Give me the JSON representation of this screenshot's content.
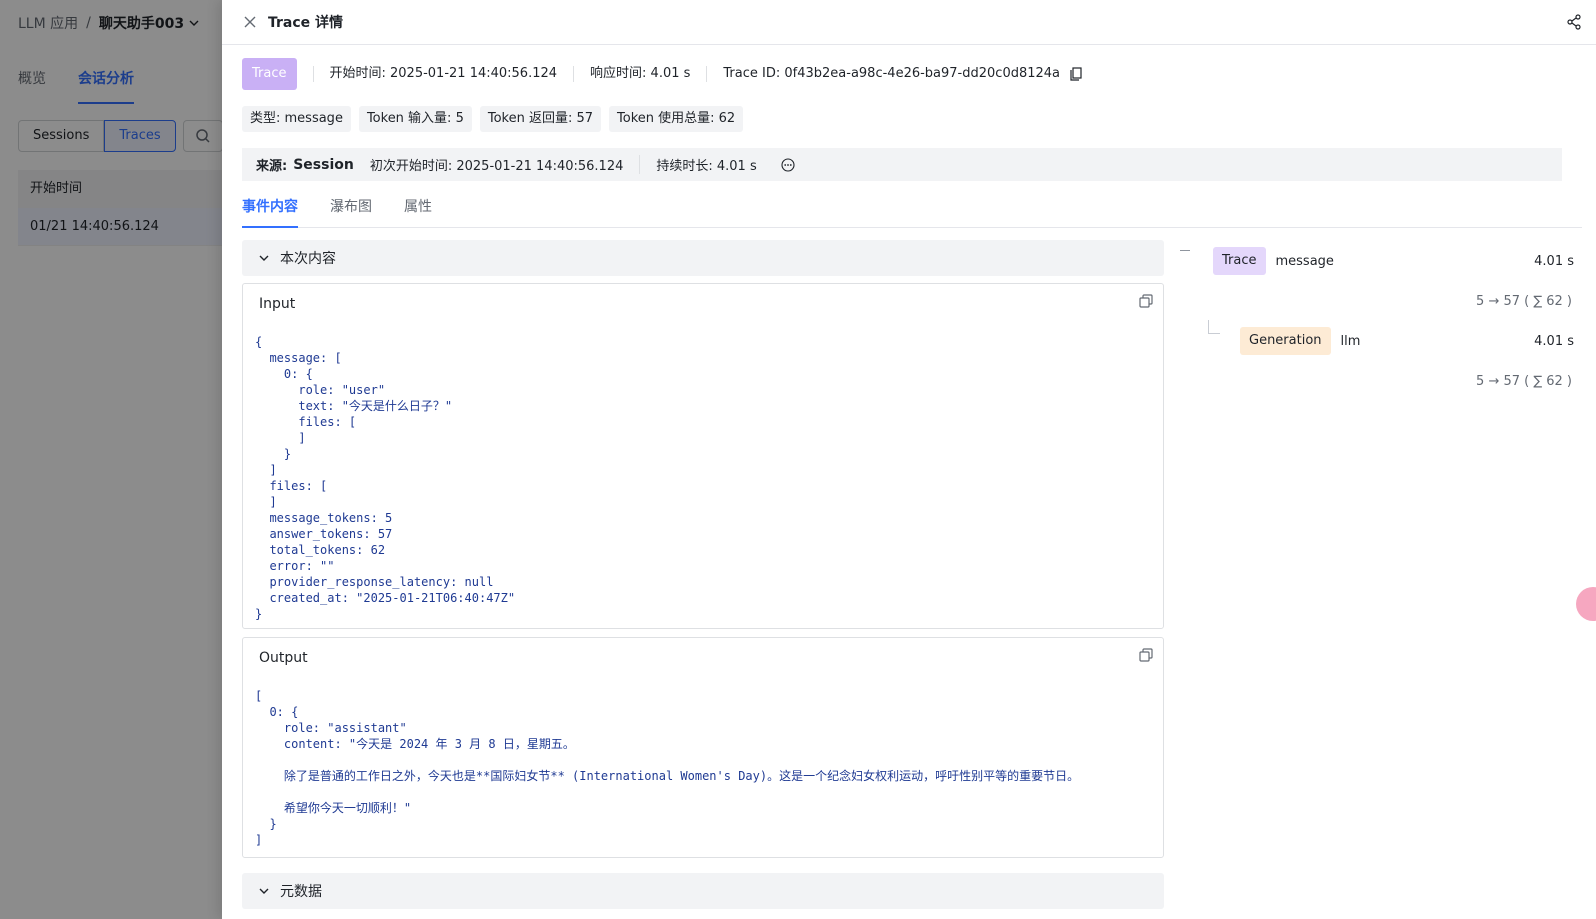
{
  "background": {
    "breadcrumb_root": "LLM 应用",
    "breadcrumb_sep": "/",
    "app_name": "聊天助手003",
    "tabs": [
      "概览",
      "会话分析"
    ],
    "segments": [
      "Sessions",
      "Traces"
    ],
    "table_header": "开始时间",
    "table_row": "01/21   14:40:56.124"
  },
  "drawer": {
    "title": "Trace 详情",
    "trace_tag": "Trace",
    "start_time": "开始时间: 2025-01-21 14:40:56.124",
    "response_time": "响应时间: 4.01 s",
    "trace_id": "Trace ID: 0f43b2ea-a98c-4e26-ba97-dd20c0d8124a",
    "badges": [
      "类型: message",
      "Token 输入量: 5",
      "Token 返回量: 57",
      "Token 使用总量: 62"
    ],
    "source_label": "来源:",
    "source_value": "Session",
    "first_start": "初次开始时间: 2025-01-21 14:40:56.124",
    "duration": "持续时长: 4.01 s",
    "tabs": [
      "事件内容",
      "瀑布图",
      "属性"
    ],
    "section_current": "本次内容",
    "section_meta": "元数据",
    "input_title": "Input",
    "output_title": "Output",
    "input_lines": [
      "{",
      "  message: [",
      "    0: {",
      "      role: \"user\"",
      "      text: \"今天是什么日子？\"",
      "      files: [",
      "      ]",
      "    }",
      "  ]",
      "  files: [",
      "  ]",
      "  message_tokens: 5",
      "  answer_tokens: 57",
      "  total_tokens: 62",
      "  error: \"\"",
      "  provider_response_latency: null",
      "  created_at: \"2025-01-21T06:40:47Z\"",
      "}"
    ],
    "output_lines": [
      "[",
      "  0: {",
      "    role: \"assistant\"",
      "    content: \"今天是 2024 年 3 月 8 日，星期五。",
      "",
      "    除了是普通的工作日之外，今天也是**国际妇女节** (International Women's Day)。这是一个纪念妇女权利运动，呼吁性别平等的重要节日。",
      "",
      "    希望你今天一切顺利！\"",
      "  }",
      "]"
    ]
  },
  "tree": {
    "trace": {
      "tag": "Trace",
      "name": "message",
      "duration": "4.01 s",
      "tokens": "5 → 57 ( ∑ 62 )"
    },
    "generation": {
      "tag": "Generation",
      "name": "llm",
      "duration": "4.01 s",
      "tokens": "5 → 57 ( ∑ 62 )"
    }
  }
}
